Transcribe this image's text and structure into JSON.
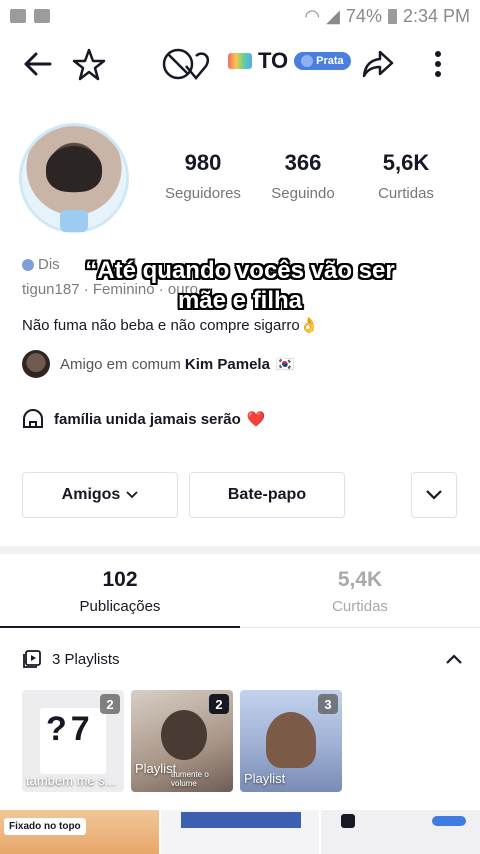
{
  "status_bar": {
    "battery": "74%",
    "time": "2:34 PM"
  },
  "header": {
    "handle": "TO",
    "badge_label": "Prata"
  },
  "stats": [
    {
      "value": "980",
      "label": "Seguidores"
    },
    {
      "value": "366",
      "label": "Seguindo"
    },
    {
      "value": "5,6K",
      "label": "Curtidas"
    }
  ],
  "profile": {
    "info_line1": "Dis",
    "info_line2": "tigun187 · Feminino · ouro",
    "overlay_quote_line1": "“Até quando vocês vão ser",
    "overlay_quote_line2": "mãe e filha",
    "bio": "Não fuma não beba e não compre sigarro👌",
    "mutual_prefix": "Amigo em comum",
    "mutual_name": "Kim Pamela",
    "mutual_flag": "🇰🇷",
    "family_text": "família unida jamais serão",
    "family_heart": "❤️"
  },
  "buttons": {
    "friends": "Amigos",
    "chat": "Bate-papo"
  },
  "tabs": [
    {
      "value": "102",
      "label": "Publicações",
      "active": true
    },
    {
      "value": "5,4K",
      "label": "Curtidas",
      "active": false
    }
  ],
  "playlists": {
    "header": "3 Playlists",
    "items": [
      {
        "count": "2",
        "caption": "?7",
        "subcaption": "tambem me s...",
        "color": "#e9e9ec"
      },
      {
        "count": "2",
        "caption": "Playlist",
        "subcaption": "aumente o volume",
        "color": "#b9a89a"
      },
      {
        "count": "3",
        "caption": "Playlist",
        "subcaption": "",
        "color": "#8fa3c9"
      }
    ]
  },
  "pinned_label": "Fixado no topo",
  "colors": {
    "accent_blue": "#4a7fe0",
    "text": "#161823",
    "muted": "#757575"
  }
}
